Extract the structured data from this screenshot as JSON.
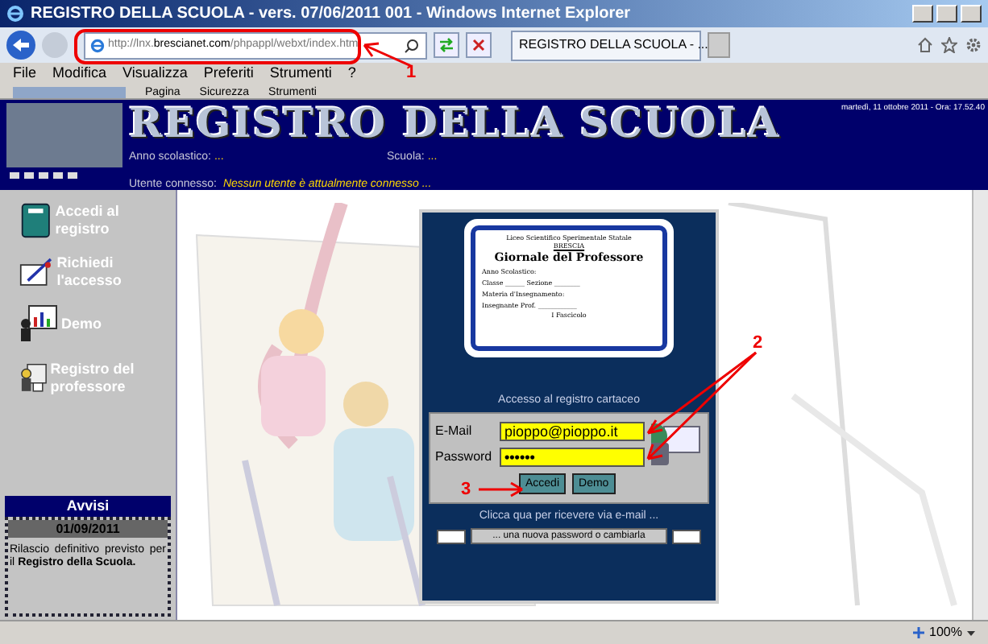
{
  "window": {
    "title": "REGISTRO DELLA SCUOLA - vers. 07/06/2011 001 - Windows Internet Explorer"
  },
  "address_bar": {
    "url_host": "http://lnx.",
    "url_domain": "brescianet.com",
    "url_path": "/phpappl/webxt/index.htm",
    "tab_title": "REGISTRO DELLA SCUOLA - ..."
  },
  "menu": [
    "File",
    "Modifica",
    "Visualizza",
    "Preferiti",
    "Strumenti",
    "?"
  ],
  "command_bar": [
    "Pagina",
    "Sicurezza",
    "Strumenti"
  ],
  "header": {
    "title": "REGISTRO DELLA SCUOLA",
    "datetime": "martedì, 11 ottobre 2011 - Ora: 17.52.40",
    "year_label": "Anno scolastico:",
    "year_value": "...",
    "school_label": "Scuola:",
    "school_value": "...",
    "user_label": "Utente connesso:",
    "user_value": "Nessun utente è attualmente connesso ..."
  },
  "sidebar": {
    "items": [
      {
        "label": "Accedi al registro",
        "kind": "book"
      },
      {
        "label": "Richiedi l'accesso",
        "kind": "form"
      },
      {
        "label": "Demo",
        "kind": "presentation"
      },
      {
        "label": "Registro del professore",
        "kind": "teacher"
      }
    ]
  },
  "notices": {
    "title": "Avvisi",
    "date": "01/09/2011",
    "text": "Rilascio definitivo previsto per il **Registro della Scuola.**"
  },
  "login": {
    "document": {
      "school": "Liceo Scientifico Sperimentale Statale",
      "city": "BRESCIA",
      "title": "Giornale del Professore",
      "lines": [
        "Anno Scolastico:",
        "Classe ______ Sezione ________",
        "Materia d'Insegnamento:",
        "Insegnante Prof. ____________"
      ],
      "footer": "I Fascicolo"
    },
    "caption": "Accesso al registro cartaceo",
    "email_label": "E-Mail",
    "email_value": "pioppo@pioppo.it",
    "password_label": "Password",
    "password_value": "••••••",
    "buttons": [
      "Accedi",
      "Demo"
    ],
    "hint": "Clicca qua per ricevere via e-mail ...",
    "reset_button": "... una nuova password o cambiarla"
  },
  "annotations": [
    "1",
    "2",
    "3"
  ],
  "status_bar": {
    "zoom": "100%"
  }
}
